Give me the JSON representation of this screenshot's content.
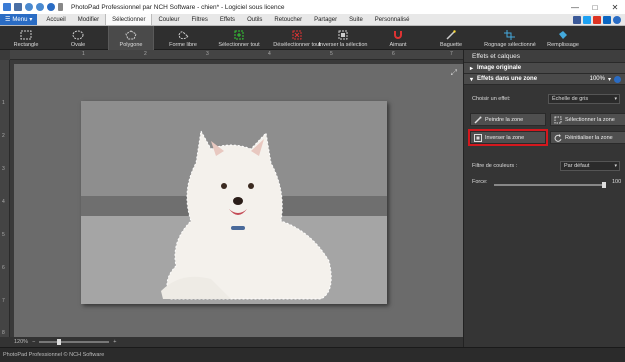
{
  "app": {
    "title": "PhotoPad Professionnel par NCH Software - chien* - Logiciel sous licence"
  },
  "menu": {
    "menu_button": "Menu",
    "tabs": [
      "Accueil",
      "Modifier",
      "Sélectionner",
      "Couleur",
      "Filtres",
      "Effets",
      "Outils",
      "Retoucher",
      "Partager",
      "Suite",
      "Personnalisé"
    ],
    "active_tab": "Sélectionner"
  },
  "toolbar": {
    "tools": [
      "Rectangle",
      "Ovale",
      "Polygone",
      "Forme libre",
      "Sélectionner tout",
      "Désélectionner tout",
      "Inverser la sélection",
      "Aimant",
      "Baguette",
      "Rognage sélectionné",
      "Remplissage"
    ],
    "active_tool": "Polygone"
  },
  "ruler": {
    "top": [
      "1",
      "2",
      "3",
      "4",
      "5",
      "6",
      "7"
    ],
    "left": [
      "1",
      "2",
      "3",
      "4",
      "5",
      "6",
      "7",
      "8"
    ]
  },
  "zoom": {
    "value": "120%"
  },
  "panel": {
    "title": "Effets et calques",
    "section1": "Image originale",
    "section2": "Effets dans une zone",
    "opacity": "100%",
    "effect_label": "Choisir un effet:",
    "effect_value": "Échelle de gris",
    "buttons": {
      "paint": "Peindre la zone",
      "select": "Sélectionner la zone",
      "invert": "Inverser la zone",
      "reset": "Réinitialiser la zone"
    },
    "filter_label": "Filtre de couleurs :",
    "filter_value": "Par défaut",
    "force_label": "Force:",
    "force_value": "100"
  },
  "status": {
    "text": "PhotoPad Professionnel © NCH Software"
  },
  "colors": {
    "accent": "#2a6cc4",
    "highlight": "#d4181e"
  }
}
